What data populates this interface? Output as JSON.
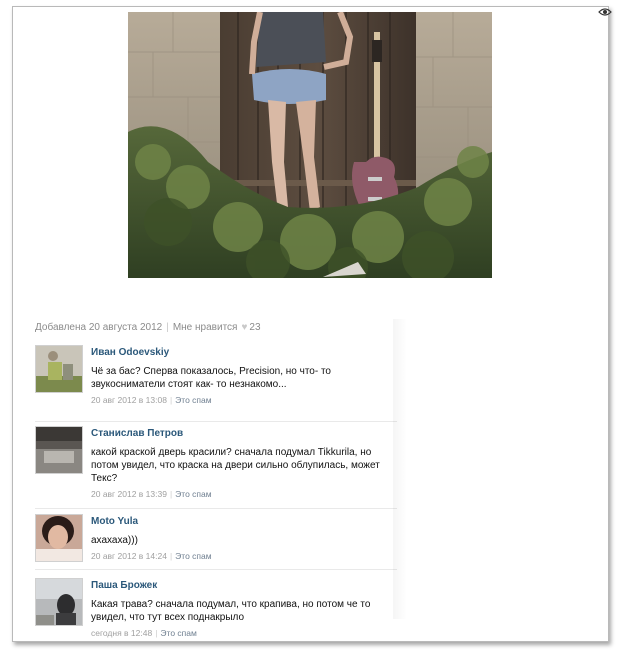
{
  "post": {
    "added_label": "Добавлена 20 августа 2012",
    "like_label": "Мне нравится",
    "like_count": "23"
  },
  "comments": [
    {
      "author": "Иван Odoevskiy",
      "text_lines": [
        "Чё за бас? Сперва показалось, Precision, но что- то",
        "звукосниматели стоят как- то незнакомо..."
      ],
      "date": "20 авг 2012 в 13:08",
      "spam_label": "Это спам"
    },
    {
      "author": "Станислав Петров",
      "text_lines": [
        "какой краской дверь красили? сначала подумал Tikkurila, но",
        "потом увидел, что краска на двери сильно облупилась, может",
        "Текс?"
      ],
      "date": "20 авг 2012 в 13:39",
      "spam_label": "Это спам"
    },
    {
      "author": "Moto Yula",
      "text_lines": [
        "ахахаха)))"
      ],
      "date": "20 авг 2012 в 14:24",
      "spam_label": "Это спам"
    },
    {
      "author": "Паша Брожек",
      "text_lines": [
        "Какая трава? сначала подумал, что крапива, но потом че то",
        "увидел, что тут всех поднакрыло"
      ],
      "date": "сегодня в 12:48",
      "spam_label": "Это спам"
    }
  ],
  "colors": {
    "author_link": "#2b587a",
    "meta_gray": "#8b8b8b"
  }
}
